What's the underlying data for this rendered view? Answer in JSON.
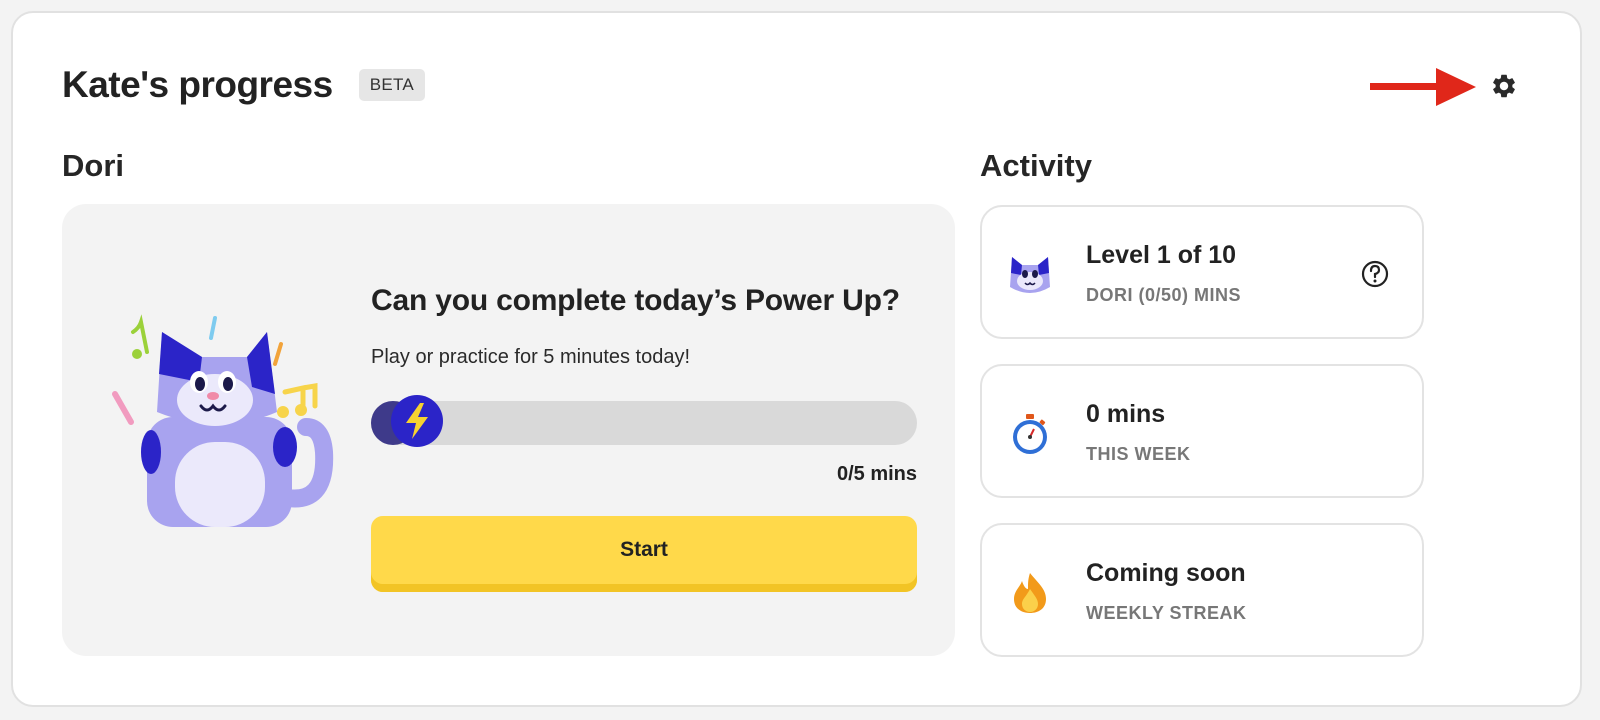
{
  "header": {
    "title": "Kate's progress",
    "badge": "BETA",
    "settings_icon": "gear-icon",
    "annotation_arrow_color": "#e0271a"
  },
  "dori": {
    "section_title": "Dori",
    "card": {
      "title": "Can you complete today’s Power Up?",
      "subtitle": "Play or practice for 5 minutes today!",
      "progress": {
        "current": 0,
        "goal": 5,
        "label": "0/5 mins"
      },
      "start_label": "Start"
    }
  },
  "activity": {
    "section_title": "Activity",
    "cards": [
      {
        "icon": "cat-avatar-icon",
        "main": "Level 1 of 10",
        "sub": "DORI (0/50) MINS",
        "help_icon": "question-circle-icon"
      },
      {
        "icon": "stopwatch-icon",
        "main": "0 mins",
        "sub": "THIS WEEK"
      },
      {
        "icon": "flame-icon",
        "main": "Coming soon",
        "sub": "WEEKLY STREAK"
      }
    ]
  },
  "colors": {
    "accent_yellow": "#ffd94a",
    "brand_blue": "#2b24c8",
    "cat_purple": "#a8a3ef"
  }
}
